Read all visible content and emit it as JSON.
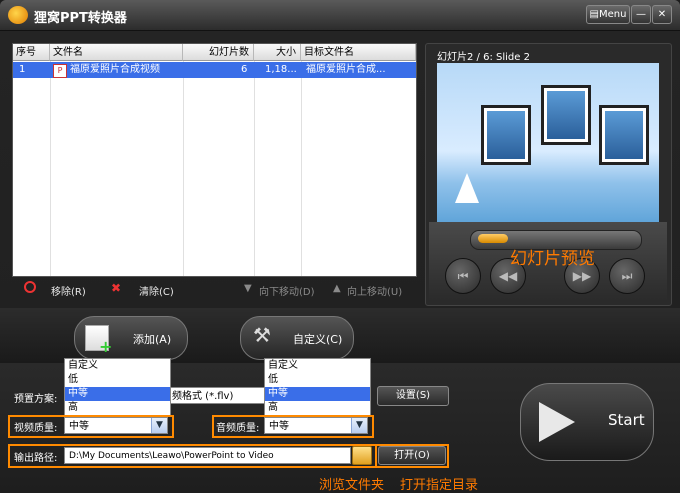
{
  "app": {
    "title": "狸窝PPT转换器",
    "menu_label": "Menu",
    "minimize_label": "—",
    "close_label": "✕"
  },
  "table": {
    "headers": [
      "序号",
      "文件名",
      "幻灯片数",
      "大小",
      "目标文件名"
    ],
    "rows": [
      {
        "index": "1",
        "filename": "福原爱照片合成视频",
        "slides": "6",
        "size": "1,18...",
        "target": "福原爱照片合成..."
      }
    ]
  },
  "toolbar": {
    "remove": "移除(R)",
    "clear": "清除(C)",
    "move_down": "向下移动(D)",
    "move_up": "向上移动(U)"
  },
  "preview": {
    "title": "幻灯片2 / 6: Slide 2",
    "annotation": "幻灯片预览"
  },
  "buttons": {
    "add": "添加(A)",
    "custom": "自定义(C)",
    "settings": "设置(S)",
    "open": "打开(O)",
    "start": "Start"
  },
  "settings": {
    "preset_label": "预置方案:",
    "preset_value_partial": "频格式 (*.flv)",
    "video_quality_label": "视频质量:",
    "video_quality_value": "中等",
    "audio_quality_label": "音频质量:",
    "audio_quality_value": "中等",
    "output_label": "输出路径:",
    "output_path": "D:\\My Documents\\Leawo\\PowerPoint to Video",
    "quality_options": [
      "自定义",
      "低",
      "中等",
      "高"
    ]
  },
  "annotations": {
    "browse": "浏览文件夹",
    "open_dir": "打开指定目录"
  },
  "colors": {
    "accent": "#ff7a00",
    "selection": "#3a6ee8"
  }
}
